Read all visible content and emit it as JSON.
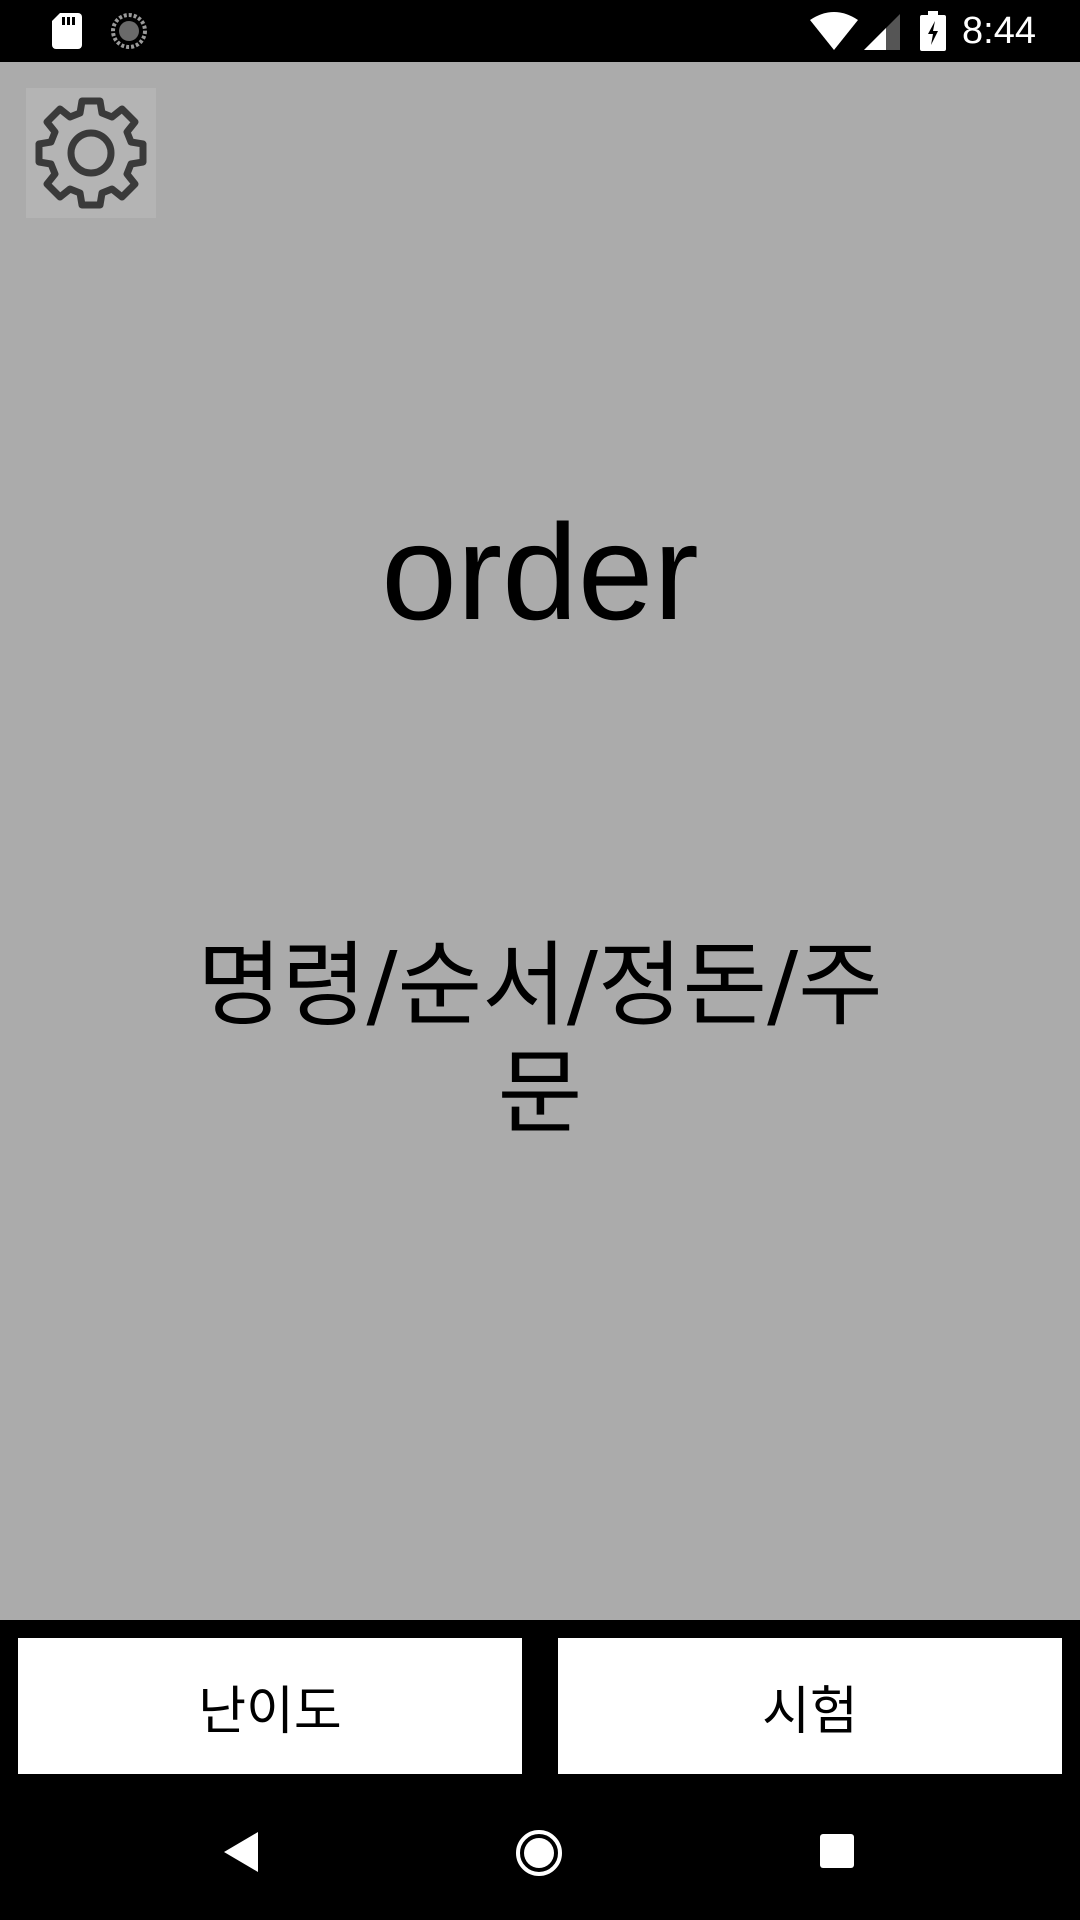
{
  "status_bar": {
    "time": "8:44",
    "icons": [
      "sd-card-icon",
      "sync-icon",
      "wifi-icon",
      "signal-icon",
      "battery-charging-icon"
    ]
  },
  "main": {
    "settings_icon": "gear-icon",
    "word": "order",
    "meaning": "명령/순서/정돈/주문",
    "background": "#ababab"
  },
  "buttons": {
    "difficulty_label": "난이도",
    "test_label": "시험"
  },
  "nav_bar": {
    "icons": [
      "back-icon",
      "home-icon",
      "recents-icon"
    ]
  }
}
